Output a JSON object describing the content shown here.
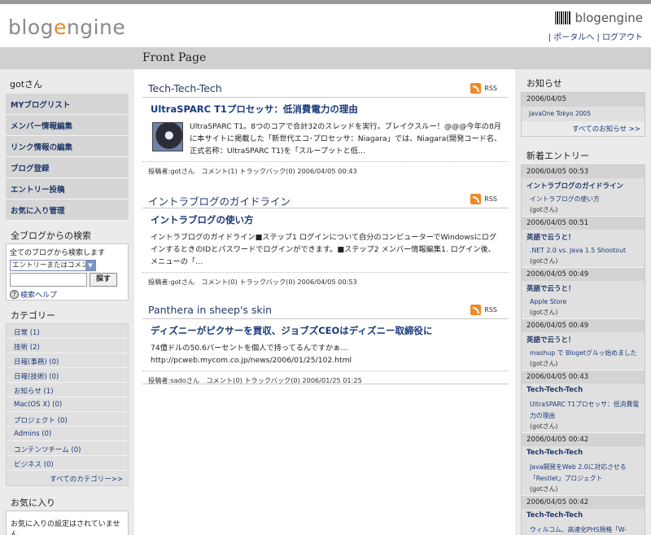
{
  "header": {
    "logo_pre": "blog",
    "logo_e": "e",
    "logo_post": "ngine",
    "mini_logo": "blogengine",
    "link_portal": "ポータルへ",
    "link_logout": "ログアウト",
    "sep": "|"
  },
  "page_title": "Front Page",
  "sidebar": {
    "user": "gotさん",
    "menu": [
      {
        "label": "MYブログリスト"
      },
      {
        "label": "メンバー情報編集"
      },
      {
        "label": "リンク情報の編集"
      },
      {
        "label": "ブログ登録"
      },
      {
        "label": "エントリー投稿"
      },
      {
        "label": "お気に入り管理"
      }
    ],
    "search_title": "全ブログからの検索",
    "search_label": "全てのブログから検索します",
    "search_select": "エントリーまたはコメント",
    "search_button": "探す",
    "search_help": "検索ヘルプ",
    "category_title": "カテゴリー",
    "categories": [
      {
        "label": "日常 (1)"
      },
      {
        "label": "技術 (2)"
      },
      {
        "label": "日報(事務) (0)"
      },
      {
        "label": "日報(技術) (0)"
      },
      {
        "label": "お知らせ (1)"
      },
      {
        "label": "Mac(OS X) (0)"
      },
      {
        "label": "プロジェクト (0)"
      },
      {
        "label": "Admins (0)"
      },
      {
        "label": "コンテンツチーム (0)"
      },
      {
        "label": "ビジネス (0)"
      }
    ],
    "categories_more": "すべてのカテゴリー>>",
    "favorites_title": "お気に入り",
    "favorites_empty": "お気に入りの設定はされていません。"
  },
  "posts": [
    {
      "blog": "Tech-Tech-Tech",
      "rss": "RSS",
      "title": "UltraSPARC T1プロセッサ：低消費電力の理由",
      "body": "UltraSPARC T1。8つのコアで合計32のスレッドを実行。ブレイクスルー！@@@今年の8月に本サイトに掲載した「新世代エコ･プロセッサ：Niagara」では、Niagara(開発コード名、正式名称：UltraSPARC T1)を「スループットと低…",
      "foot": "投稿者:gotさん　コメント(1) トラックバック(0) 2006/04/05 00:43"
    },
    {
      "blog": "イントラブログのガイドライン",
      "rss": "RSS",
      "title": "イントラブログの使い方",
      "body": "イントラブログのガイドライン■ステップ1 ログインについて自分のコンピューターでWindowsにログインするときのIDとパスワードでログインができます。■ステップ2 メンバー情報編集1. ログイン後、メニューの「…",
      "foot": "投稿者:gotさん　コメント(0) トラックバック(0) 2006/04/05 00:53"
    },
    {
      "blog": "Panthera in sheep's skin",
      "rss": "RSS",
      "title": "ディズニーがピクサーを買収、ジョブズCEOはディズニー取締役に",
      "body": "74億ドルの50.6パーセントを個人で持ってるんですかぁ…http://pcweb.mycom.co.jp/news/2006/01/25/102.html",
      "foot": "投稿者:sadoさん　コメント(0) トラックバック(0) 2006/01/25 01:25"
    }
  ],
  "right": {
    "news_title": "お知らせ",
    "news_date": "2006/04/05",
    "news_link": "JavaOne Tokyo 2005",
    "news_more": "すべてのお知らせ >>",
    "entries_title": "新着エントリー",
    "entries": [
      {
        "date": "2006/04/05 00:53",
        "blog": "イントラブログのガイドライン",
        "title": "イントラブログの使い方",
        "author": "(gotさん)"
      },
      {
        "date": "2006/04/05 00:51",
        "blog": "英語で云うと！",
        "title": ".NET 2.0 vs. Java 1.5 Shootout",
        "author": "(gotさん)"
      },
      {
        "date": "2006/04/05 00:49",
        "blog": "英語で云うと！",
        "title": "Apple Store",
        "author": "(gotさん)"
      },
      {
        "date": "2006/04/05 00:49",
        "blog": "英語で云うと！",
        "title": "mashup で Blogetグルッ始めました",
        "author": "(gotさん)"
      },
      {
        "date": "2006/04/05 00:43",
        "blog": "Tech-Tech-Tech",
        "title": "UltraSPARC T1プロセッサ：低消費電力の理由",
        "author": "(gotさん)"
      },
      {
        "date": "2006/04/05 00:42",
        "blog": "Tech-Tech-Tech",
        "title": "Java開発をWeb 2.0に対応させる「Restlet」プロジェクト",
        "author": "(gotさん)"
      },
      {
        "date": "2006/04/05 00:42",
        "blog": "Tech-Tech-Tech",
        "title": "ウィルコム、高速化PHS規格「W-OAM」",
        "author": ""
      }
    ]
  }
}
